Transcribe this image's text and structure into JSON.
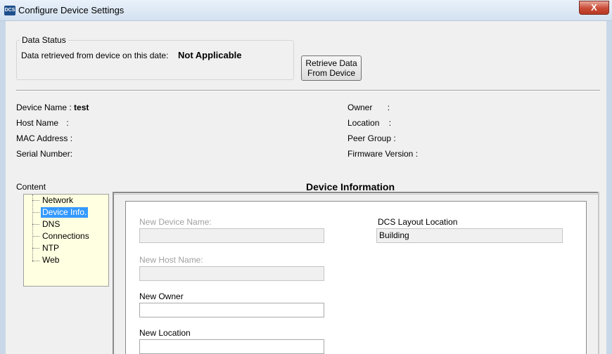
{
  "window": {
    "title": "Configure Device Settings",
    "icon_text": "DCS",
    "close_label": "X"
  },
  "data_status": {
    "legend": "Data Status",
    "retrieved_label": "Data retrieved from device on this date:",
    "retrieved_value": "Not Applicable",
    "retrieve_button_line1": "Retrieve Data",
    "retrieve_button_line2": "From Device"
  },
  "device_info": {
    "device_name_label": "Device Name :",
    "device_name_value": "test",
    "host_name_label": "Host Name",
    "host_name_sep": ":",
    "mac_label": "MAC Address :",
    "serial_label": "Serial Number:",
    "owner_label": "Owner",
    "owner_sep": ":",
    "location_label": "Location",
    "location_sep": ":",
    "peer_group_label": "Peer Group :",
    "firmware_label": "Firmware Version :"
  },
  "content": {
    "label": "Content",
    "items": [
      {
        "label": "Network",
        "selected": false
      },
      {
        "label": "Device Info.",
        "selected": true
      },
      {
        "label": "DNS",
        "selected": false
      },
      {
        "label": "Connections",
        "selected": false
      },
      {
        "label": "NTP",
        "selected": false
      },
      {
        "label": "Web",
        "selected": false
      }
    ]
  },
  "panel": {
    "title": "Device Information",
    "new_device_name_label": "New Device Name:",
    "new_device_name_value": "",
    "new_host_name_label": "New Host Name:",
    "new_host_name_value": "",
    "new_owner_label": "New Owner",
    "new_owner_value": "",
    "new_location_label": "New Location",
    "new_location_value": "",
    "layout_location_label": "DCS Layout Location",
    "layout_location_value": "Building"
  },
  "colors": {
    "selection": "#3399ff",
    "tree_background": "#ffffe1",
    "close_button": "#c94a35"
  }
}
